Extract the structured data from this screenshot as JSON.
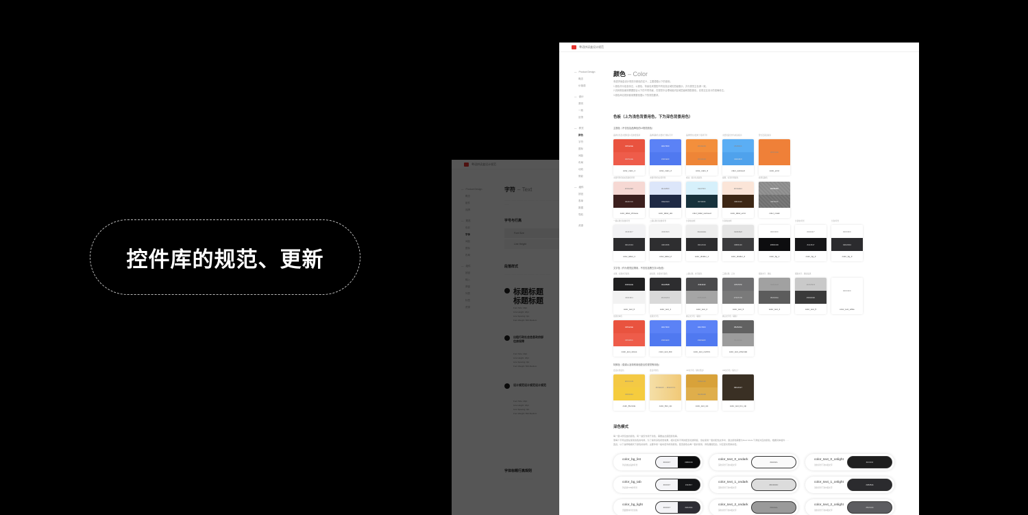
{
  "banner": {
    "label": "控件库的规范、更新"
  },
  "back_doc": {
    "app_title": "粤语拼读盒设计规范",
    "nav": [
      "Product Design",
      "概念",
      "组件",
      "品牌",
      "规范",
      "色彩",
      "字体",
      "间距",
      "图标",
      "布局",
      "组件",
      "按钮",
      "输入",
      "弹窗",
      "列表",
      "标签",
      "资源"
    ],
    "title": "字符",
    "title_en": "– Text",
    "section_size": "字号与行高",
    "font_size_label": "Font Size",
    "line_height_label": "Line Height",
    "section_para": "段落样式",
    "heading_sample": "标题标题\n标题标题",
    "sample2": "出租行政社会信息政府部\n住房保障",
    "sample3": "设计规范设计规范设计规范",
    "specs": [
      "Font Size: 20pt",
      "Line Height: 24pt",
      "Line Spacing: 0pt",
      "Font Weight: 500 Medium"
    ],
    "footer_title": "字体标题行高规则"
  },
  "front_doc": {
    "app_title": "粤语拼读盒设计规范",
    "nav": {
      "group1": [
        "Product Design",
        "概念",
        "价值观"
      ],
      "group2": [
        "设计",
        "原则",
        "一致",
        "反馈"
      ],
      "group3": [
        "样式",
        "颜色",
        "字符",
        "图标",
        "间距",
        "布局",
        "动效",
        "阴影"
      ],
      "group4": [
        "组件",
        "按钮",
        "表单",
        "数据",
        "导航"
      ],
      "group5": [
        "资源"
      ]
    },
    "title": "颜色",
    "title_en": "– Color",
    "intro": [
      "粤语拼读盒设计规范中颜色的定义，主要遵循以下的原则。",
      "1.颜色作为信息传达，以颜色、背景色来搭配不同信息区域的层级展示，并与视觉主色调一致。",
      "2.具体颜色使用需要配合以下的不同场景，在视觉中合理地组织区域层级和搭配颜色，实现交互设计的准确传达。",
      "3.颜色命名规则使用需要依据以下的规范要求。"
    ],
    "palette_heading": "色板（上为浅色背景用色，下为深色背景用色）",
    "sub_theme": "主题色（不仅包括品牌色的UI规范颜色）",
    "sub_text": "文字色（作为视觉区隔用，不仅包括黑白灰UI色值）",
    "sub_special": "特殊色（强调以及特别用色配合的视觉等用色）",
    "rows": [
      {
        "caps": [
          "品牌主色及主要按钮以及重要强调",
          "品牌辅助色主要用于图标引导",
          "品牌橙色主要用于强调引导",
          "主要浅蓝色作为成功提示",
          "警告及错误提示"
        ],
        "cards": [
          {
            "top": "#F54A3E",
            "bottom": "#FF5A4E",
            "name": "color_main_1",
            "tc": "#E9533F",
            "bc": "#EE5C4A"
          },
          {
            "top": "#4C7FFF",
            "bottom": "#3D6EFF",
            "name": "color_main_2",
            "tc": "#5B82F6",
            "bc": "#5079F0"
          },
          {
            "top": "#FF8A3D",
            "bottom": "#FF9A4D",
            "name": "color_main_3",
            "tc": "#F38F3C",
            "bc": "#EE8537"
          },
          {
            "top": "#56B6FF",
            "bottom": "#48A6F8",
            "name": "color_succeed",
            "tc": "#5BAEF4",
            "bc": "#4FA2EC"
          },
          {
            "top": "#F57A3D",
            "bottom": "",
            "name": "color_error",
            "tc": "#EF8038",
            "bc": "",
            "single": true
          }
        ]
      },
      {
        "caps": [
          "主要背景色和标签颜色背景",
          "次要背景色标签背景",
          "成功、提示信息颜色",
          "提醒、标签背景颜色",
          "遮罩层颜色"
        ],
        "cards": [
          {
            "top": "#FDE3E0",
            "bottom": "#4A1F1C",
            "name": "color_label_chinese",
            "tc": "#F6D8D3",
            "bc": "#3C1F1D"
          },
          {
            "top": "#E1EBFF",
            "bottom": "#1E2A44",
            "name": "color_label_dot",
            "tc": "#DCE6FA",
            "bc": "#1F2A45"
          },
          {
            "top": "#E1F5FF",
            "bottom": "#17323C",
            "name": "color_label_succeed",
            "tc": "#D6F0FB",
            "bc": "#17323C"
          },
          {
            "top": "#FFEEE1",
            "bottom": "#3D2410",
            "name": "color_label_error",
            "tc": "#FBE5D8",
            "bc": "#3D2715"
          },
          {
            "top": "#8D8D8D",
            "bottom": "#6F6F6F",
            "name": "color_mask",
            "tc": "#8C8C8C",
            "bc": "#777777",
            "pattern": true
          }
        ]
      },
      {
        "caps": [
          "一级标题分割线/背景",
          "二级标题分割线/背景",
          "分割线/边框",
          "分割线/边框",
          "",
          "分割线/背景",
          "分割/背景"
        ],
        "cards": [
          {
            "top": "#F4F4F7",
            "bottom": "#2C2C34",
            "name": "color_label_1",
            "tc": "#F2F2F4",
            "bc": "#2C2C2E"
          },
          {
            "top": "#F6F6F6",
            "bottom": "#2F2F36",
            "name": "color_label_2",
            "tc": "#F5F5F5",
            "bc": "#2E2E30"
          },
          {
            "top": "#EEEEEE",
            "bottom": "#2C2C34",
            "name": "color_divider_1",
            "tc": "#EDEDED",
            "bc": "#2C2C2E"
          },
          {
            "top": "#E8E8E8",
            "bottom": "#383C40",
            "name": "color_divider_2",
            "tc": "#E4E4E4",
            "bc": "#3B3B3D"
          },
          {
            "top": "#FFFFFF",
            "bottom": "#0B0C0D",
            "name": "color_bg_1",
            "tc": "#FFFFFF",
            "bc": "#0D0D0F"
          },
          {
            "top": "#F4F4F7",
            "bottom": "#141517",
            "name": "color_bg_2",
            "tc": "#FFFFFF",
            "bc": "#161618"
          },
          {
            "top": "#FFFFFF",
            "bottom": "#2D2D34",
            "name": "color_bg_3",
            "tc": "#FFFFFF",
            "bc": "#2B2B2E"
          }
        ]
      },
      {
        "caps": [
          "主题、标题文字颜色",
          "副标题、主要文字颜色",
          "二级标题、文字颜色",
          "三级标题、正文",
          "辅助文字、图标",
          "辅助文字、图标描述",
          ""
        ],
        "cards": [
          {
            "top": "#1D1E1E",
            "bottom": "#F0F0F4",
            "name": "color_text_0",
            "tc": "#1F1F20",
            "bc": "#F2F2F2"
          },
          {
            "top": "#2A2B2B",
            "bottom": "#D2D2D2",
            "name": "color_text_1",
            "tc": "#2D2D2F",
            "bc": "#D9D9D9"
          },
          {
            "top": "#434343",
            "bottom": "#ABABAB",
            "name": "color_text_2",
            "tc": "#4A4A4C",
            "bc": "#A5A5A5"
          },
          {
            "top": "#707070",
            "bottom": "#7D7D7D",
            "name": "color_text_3",
            "tc": "#6E6E70",
            "bc": "#7A7A7A"
          },
          {
            "top": "#A8A8A8",
            "bottom": "#5A5A5A",
            "name": "color_text_4",
            "tc": "#A1A1A1",
            "bc": "#5C5C5C"
          },
          {
            "top": "#C5C5C5",
            "bottom": "#3D3D3D",
            "name": "color_text_5",
            "tc": "#C9C9C9",
            "bc": "#3A3A3A"
          },
          {
            "top": "#FFFFFF",
            "bottom": "",
            "name": "color_text_white",
            "tc": "#FFFFFF",
            "bc": "",
            "single": true
          }
        ]
      },
      {
        "caps": [
          "强调文本色",
          "强调文字色",
          "确认文字色（辅助）",
          "确认文字色（辅助）"
        ],
        "cards": [
          {
            "top": "#F54A3E",
            "bottom": "#F5483C",
            "name": "color_text_stress",
            "tc": "#E9533F",
            "bc": "#EE5C4A"
          },
          {
            "top": "#4C7FFF",
            "bottom": "#3D6EFF",
            "name": "color_text_link",
            "tc": "#5B82F6",
            "bc": "#5079F0"
          },
          {
            "top": "#4C7FFF",
            "bottom": "#3D6EFF",
            "name": "color_text_confirm",
            "tc": "#5B82F6",
            "bc": "#5079F0"
          },
          {
            "top": "#5A5A5A",
            "bottom": "#9A9A9A",
            "name": "color_text_otherstat",
            "tc": "#616161",
            "bc": "#9C9C9C"
          }
        ]
      },
      {
        "caps": [
          "会员标签底色",
          "会员背景色",
          "VIP文字色（通常黑底）",
          "VIP文字色（深色上）"
        ],
        "cards": [
          {
            "top": "#FFCC33",
            "bottom": "#FFD044",
            "name": "color_fbonvite",
            "tc": "#F4C944",
            "bc": "#F5CC3E"
          },
          {
            "top": "#FFE0A6",
            "bottom": "",
            "name": "color_bkn_vip",
            "tc": "#F4D89A",
            "bc": "",
            "single": true,
            "gradient": true,
            "label": "#FFE0A6 → #FECF7A"
          },
          {
            "top": "#D8A136",
            "bottom": "#E1B04B",
            "name": "color_text_vip",
            "tc": "#D8A23A",
            "bc": "#DFAE4B"
          },
          {
            "top": "#3C2C17",
            "bottom": "",
            "name": "color_text_bm_vip",
            "tc": "#3A3024",
            "bc": "",
            "single": true
          }
        ]
      }
    ],
    "dark_heading": "深色模式",
    "dark_intro": [
      "每一套UI所包含的颜色，有一些仅作用于浅色，需要由此搭配颜色等。",
      "而每个不同主题在使用浅色的时候，为了保持深色视觉效果，相对应有不同的配置和透明度，但在使用一套的配色文件时，通过颜色需要为Dark Mode下添加对应的颜色，根据具体组件……",
      "因此，以下是明暗模式下颜色的说明，主要作用一般将值作用到颜色，配置颜色在每一套的使用，调色器搭配后，对应变化更换的值。"
    ],
    "pills": [
      {
        "name": "color_bg_list",
        "desc": "列表类白底的背景",
        "l": "#F4F4F7",
        "r": "#0B0C0D",
        "full": false
      },
      {
        "name": "color_bg_tab",
        "desc": "列表类TAB的背景",
        "l": "#F4F4F7",
        "r": "#141517",
        "full": false
      },
      {
        "name": "color_bg_light",
        "desc": "页面整体背景浅色",
        "l": "#F4F4F7",
        "r": "#2D2D34",
        "full": false
      },
      {
        "name": "color_text_0_ondark",
        "desc": "深色背景下的1级文字",
        "l": "#FAFAFA",
        "r": "",
        "full": true
      },
      {
        "name": "color_text_1_ondark",
        "desc": "深色背景下的1级文字",
        "l": "#DCDCDC",
        "r": "",
        "full": true
      },
      {
        "name": "color_text_2_ondark",
        "desc": "深色背景下的2级文字",
        "l": "#9A9A9A",
        "r": "",
        "full": true
      },
      {
        "name": "color_text_0_onlight",
        "desc": "浅色背景下的1级文字",
        "l": "#1F1F1F",
        "r": "",
        "full": true
      },
      {
        "name": "color_text_1_onlight",
        "desc": "浅色背景下的1级文字",
        "l": "#2B2B2E",
        "r": "",
        "full": true
      },
      {
        "name": "color_text_2_onlight",
        "desc": "浅色背景下的2级文字",
        "l": "#5C5C60",
        "r": "",
        "full": true
      }
    ]
  }
}
